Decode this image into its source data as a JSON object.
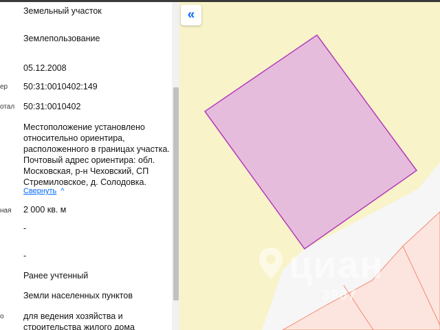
{
  "map_button": {
    "icon": "double-chevron-left-icon",
    "glyph": "«"
  },
  "details": {
    "rows": [
      {
        "label": "",
        "value": "Земельный участок"
      },
      {
        "label": "",
        "value": "Землепользование"
      },
      {
        "label": "",
        "value": "05.12.2008"
      },
      {
        "label": "ер",
        "value": "50:31:0010402:149"
      },
      {
        "label": "отал",
        "value": "50:31:0010402"
      },
      {
        "label": "",
        "value": "Местоположение установлено относительно ориентира, расположенного в границах участка. Почтовый адрес ориентира: обл. Московская, р-н Чеховский, СП Стремиловское, д. Солодовка."
      },
      {
        "label": "ная",
        "value": "2 000 кв. м"
      },
      {
        "label": "",
        "value": "-"
      },
      {
        "label": "",
        "value": "-"
      },
      {
        "label": "",
        "value": "Ранее учтенный"
      },
      {
        "label": "",
        "value": "Земли населенных пунктов"
      },
      {
        "label": "о",
        "value": "для ведения хозяйства и строительства жилого дома"
      }
    ],
    "collapse_link": "Свернуть"
  },
  "watermark": {
    "text": "циан",
    "number": "3907"
  },
  "colors": {
    "map_background": "#f9f3c9",
    "parcel_fill": "#e6bcdc",
    "parcel_stroke": "#b33bba",
    "road": "#f6f6f6",
    "neighbor_fill": "#fde5df",
    "neighbor_stroke": "#f18a72",
    "accent": "#0468ff"
  }
}
